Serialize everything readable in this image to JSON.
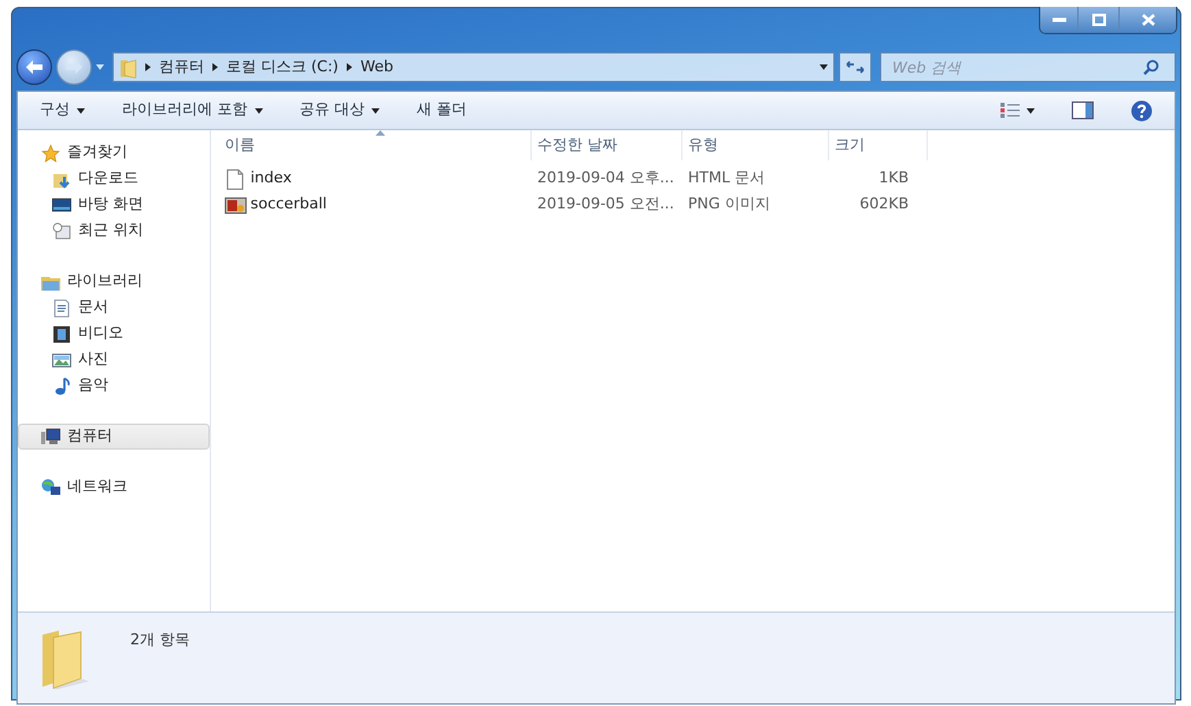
{
  "address": {
    "crumbs": [
      "컴퓨터",
      "로컬 디스크 (C:)",
      "Web"
    ]
  },
  "search": {
    "placeholder": "Web 검색"
  },
  "toolbar": {
    "items": [
      {
        "label": "구성",
        "dropdown": true
      },
      {
        "label": "라이브러리에 포함",
        "dropdown": true
      },
      {
        "label": "공유 대상",
        "dropdown": true
      },
      {
        "label": "새 폴더",
        "dropdown": false
      }
    ]
  },
  "sidebar": {
    "groups": [
      {
        "label": "즐겨찾기",
        "selected": false,
        "children": [
          {
            "label": "다운로드",
            "selected": false
          },
          {
            "label": "바탕 화면",
            "selected": false
          },
          {
            "label": "최근 위치",
            "selected": false
          }
        ]
      },
      {
        "label": "라이브러리",
        "selected": false,
        "children": [
          {
            "label": "문서",
            "selected": false
          },
          {
            "label": "비디오",
            "selected": false
          },
          {
            "label": "사진",
            "selected": false
          },
          {
            "label": "음악",
            "selected": false
          }
        ]
      },
      {
        "label": "컴퓨터",
        "selected": true
      },
      {
        "label": "네트워크",
        "selected": false
      }
    ]
  },
  "table": {
    "columns": [
      {
        "label": "이름",
        "sorted": true
      },
      {
        "label": "수정한 날짜",
        "sorted": false
      },
      {
        "label": "유형",
        "sorted": false
      },
      {
        "label": "크기",
        "sorted": false
      }
    ],
    "rows": [
      {
        "kind": "document",
        "name": "index",
        "modified": "2019-09-04 오후...",
        "type": "HTML 문서",
        "size": "1KB"
      },
      {
        "kind": "image",
        "name": "soccerball",
        "modified": "2019-09-05 오전...",
        "type": "PNG 이미지",
        "size": "602KB"
      }
    ]
  },
  "status_bar": {
    "text": "2개 항목"
  }
}
